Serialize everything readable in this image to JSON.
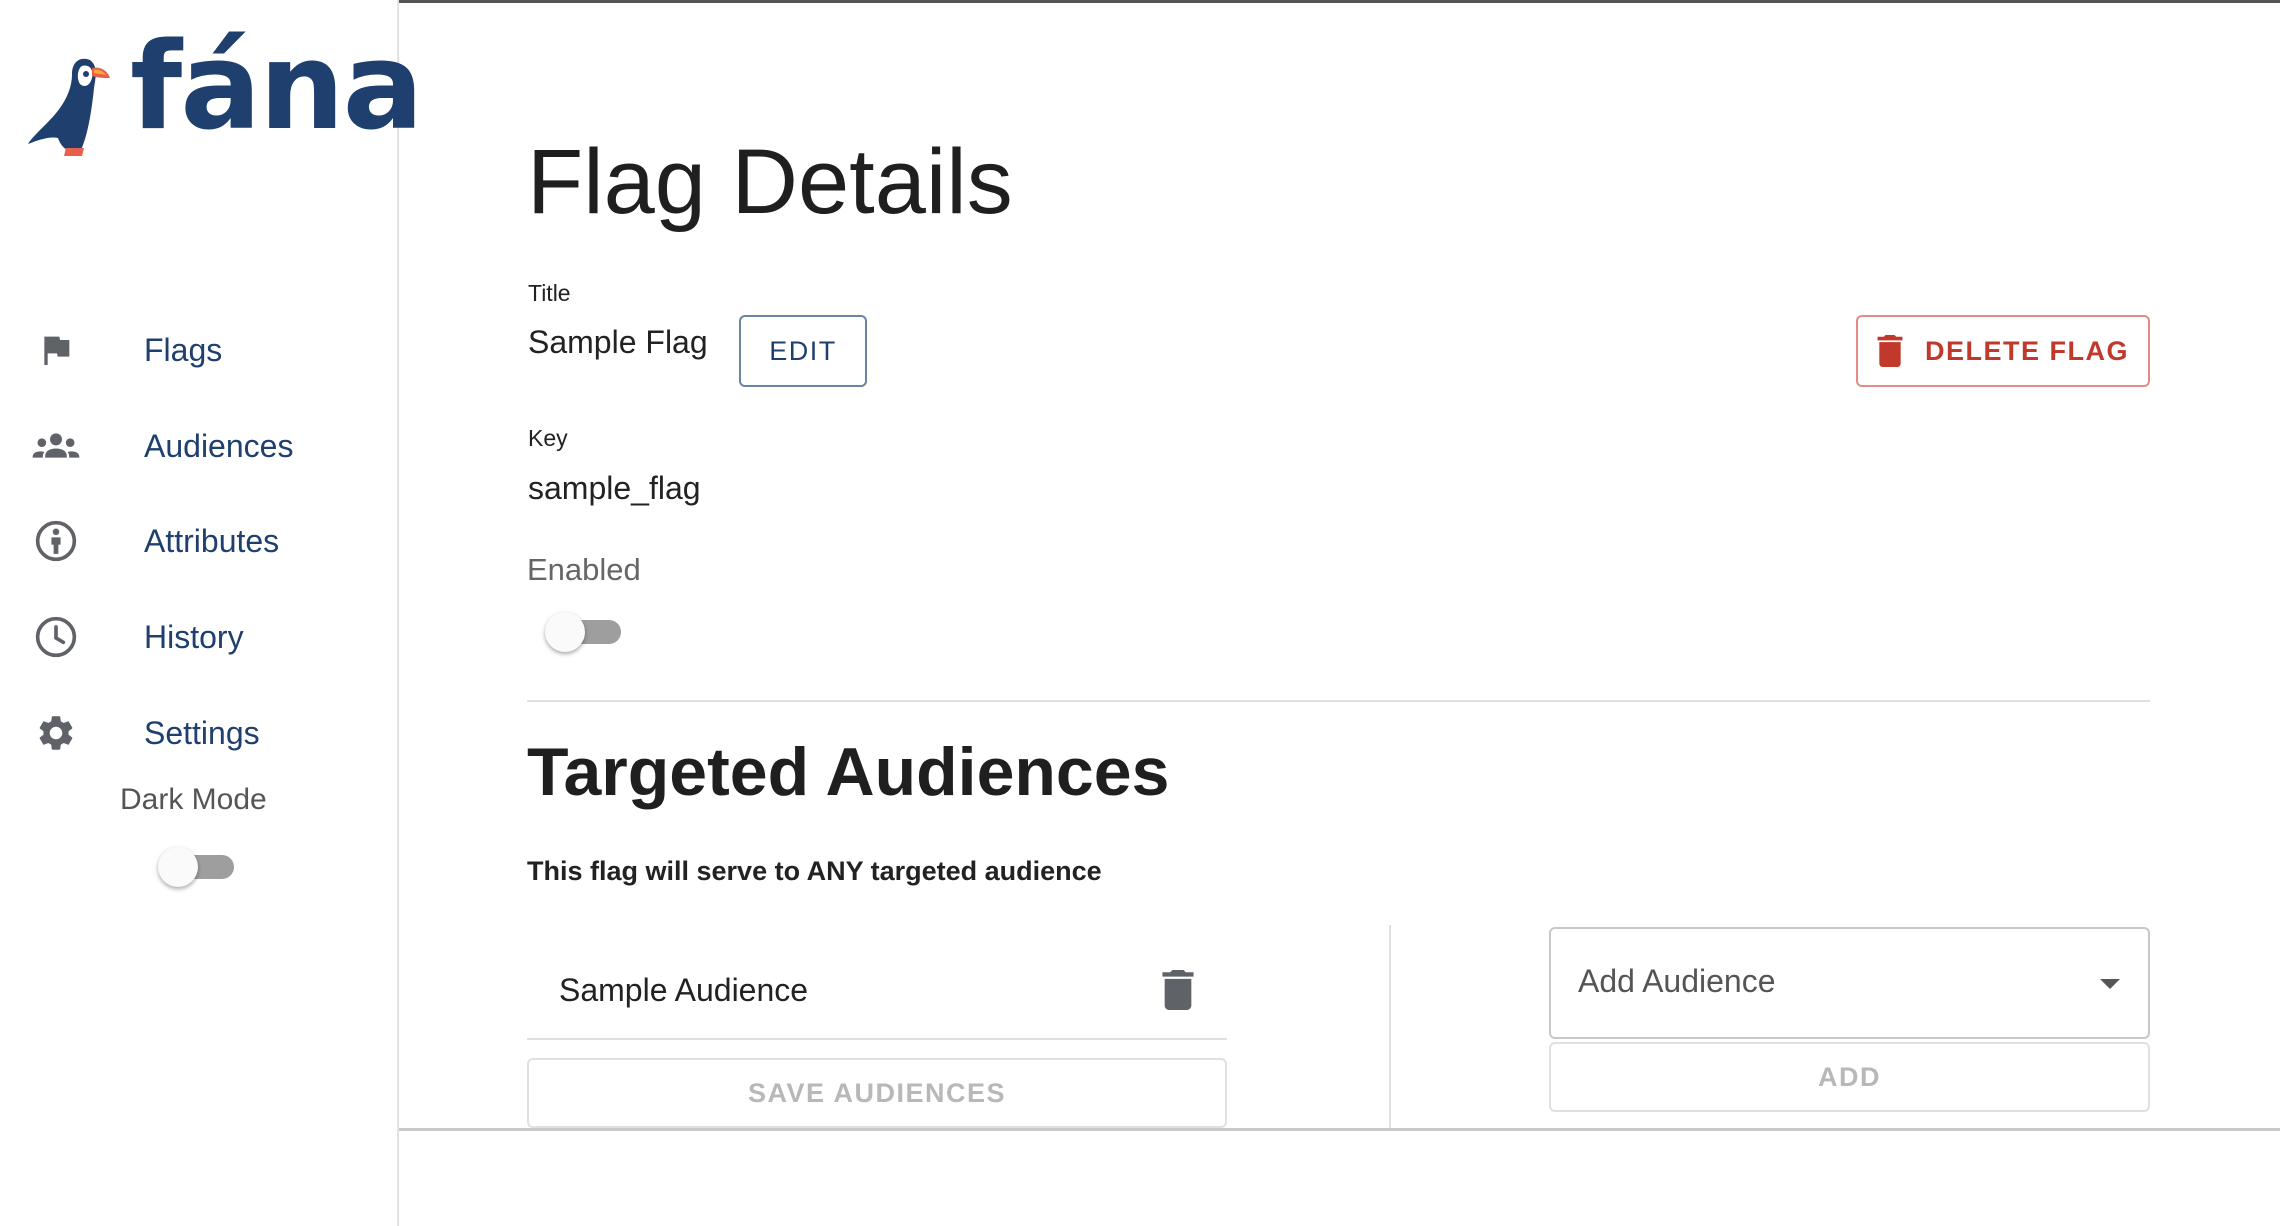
{
  "brand": {
    "name": "fána"
  },
  "sidebar": {
    "items": [
      {
        "label": "Flags",
        "icon": "flag-icon"
      },
      {
        "label": "Audiences",
        "icon": "group-icon"
      },
      {
        "label": "Attributes",
        "icon": "person-info-icon"
      },
      {
        "label": "History",
        "icon": "clock-icon"
      },
      {
        "label": "Settings",
        "icon": "gear-icon"
      }
    ],
    "dark_mode": {
      "label": "Dark Mode",
      "enabled": false
    }
  },
  "flag_details": {
    "page_title": "Flag Details",
    "title_label": "Title",
    "title_value": "Sample Flag",
    "edit_button": "EDIT",
    "delete_button": "DELETE FLAG",
    "key_label": "Key",
    "key_value": "sample_flag",
    "enabled_label": "Enabled",
    "enabled": false
  },
  "targeted_audiences": {
    "section_title": "Targeted Audiences",
    "description": "This flag will serve to ANY targeted audience",
    "audiences": [
      "Sample Audience"
    ],
    "save_button": "SAVE AUDIENCES",
    "add_select_placeholder": "Add Audience",
    "add_button": "ADD"
  },
  "colors": {
    "brand_navy": "#1f3f6e",
    "danger_red": "#c0392b",
    "disabled_grey": "#b8b8b8"
  }
}
